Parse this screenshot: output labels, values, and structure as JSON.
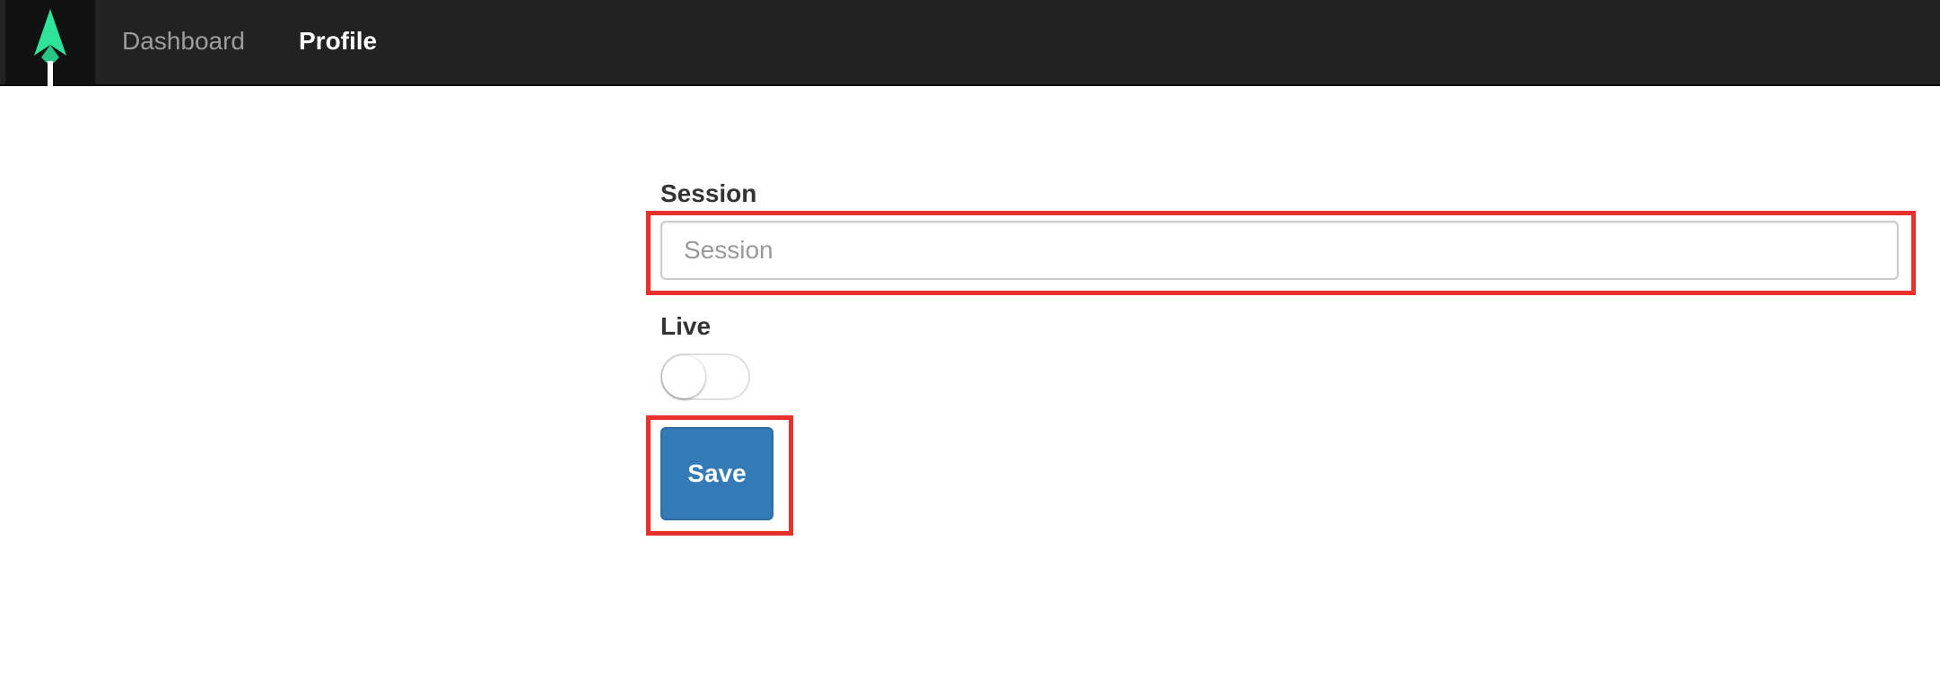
{
  "nav": {
    "links": [
      {
        "label": "Dashboard",
        "active": false
      },
      {
        "label": "Profile",
        "active": true
      }
    ],
    "logo_icon": "green-arrow-logo-icon"
  },
  "form": {
    "session": {
      "label": "Session",
      "placeholder": "Session",
      "value": ""
    },
    "live": {
      "label": "Live",
      "checked": false
    },
    "save_label": "Save"
  },
  "colors": {
    "navbar_bg": "#222222",
    "logo_green": "#2ee39a",
    "primary_button": "#337ab7",
    "highlight_box": "#e8312a"
  }
}
